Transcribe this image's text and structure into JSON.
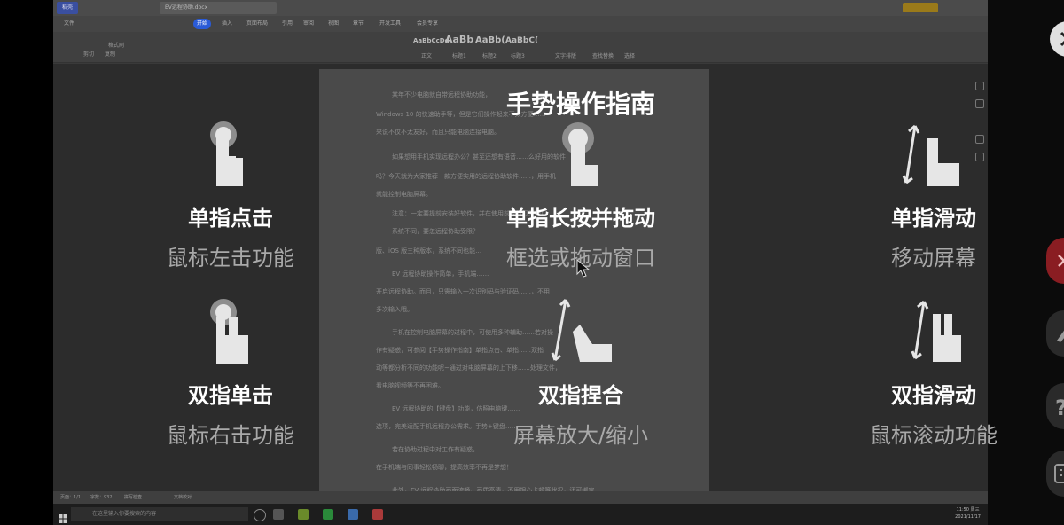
{
  "desktop": {
    "tabs": [
      "稻壳",
      "EV远程协助.docx"
    ],
    "menu": [
      "文件",
      "开始",
      "插入",
      "页面布局",
      "引用",
      "审阅",
      "视图",
      "章节",
      "开发工具",
      "会员专享"
    ],
    "ribbon_labels": [
      "剪切",
      "复制",
      "格式刷",
      "正文",
      "标题1",
      "标题2",
      "标题3",
      "文字排版",
      "查找替换",
      "选择"
    ],
    "style_previews": [
      "AaBbCcDd",
      "AaBb",
      "AaBb(",
      "AaBbC("
    ],
    "doc_lines": [
      "某年不少电脑就自带远程协助功能，",
      "Windows 10 的快速助手等，但是它们操作起来不太方便……",
      "来说不仅不太友好，而且只能电脑连接电脑。",
      "如果想用手机实现远程办公？甚至还想有语音……么好用的软件",
      "吗？今天就为大家推荐一款方便实用的远程协助软件……，用手机",
      "就能控制电脑屏幕。",
      "注意：一定要提前安装好软件，并在使用前先行打开哦！",
      "系统不同，要怎远程协助受限？",
      "版、iOS 版三种版本，系统不同也能…",
      "EV 远程协助操作简单，手机端……",
      "开启远程协助。而且，只需输入一次识别码与验证码……，不用",
      "多次输入哦。",
      "手机在控制电脑屏幕的过程中，可使用多种辅助……若对操",
      "作有疑惑，可参阅【手势操作指南】单指点击、单指……双指",
      "动等都分析不同的功能呢~通过对电脑屏幕的上下移……处理文件，",
      "看电脑视频等不再困难。",
      "EV 远程协助的【键盘】功能，仿照电脑键……",
      "选项，完美适配手机远程办公需求。手势+键盘……",
      "若在协助过程中对工作有疑惑，……",
      "在手机端与同事轻松畅聊，提高效率不再是梦想！",
      "此外，EV 远程协助画面流畅、画质高清，不用担心卡顿等状况，还可绑定"
    ],
    "status_items": [
      "页面：1/1",
      "字数：932",
      "拼写检查",
      "文档校对"
    ],
    "taskbar_search": "在这里输入你要搜索的内容",
    "clock_time": "11:50 周三",
    "clock_date": "2021/11/17"
  },
  "overlay": {
    "title": "手势操作指南",
    "gestures": [
      {
        "title": "单指点击",
        "subtitle": "鼠标左击功能",
        "icon": "single-finger-tap-icon"
      },
      {
        "title": "单指长按并拖动",
        "subtitle": "框选或拖动窗口",
        "icon": "single-finger-long-press-icon"
      },
      {
        "title": "单指滑动",
        "subtitle": "移动屏幕",
        "icon": "single-finger-swipe-icon"
      },
      {
        "title": "双指单击",
        "subtitle": "鼠标右击功能",
        "icon": "two-finger-tap-icon"
      },
      {
        "title": "双指捏合",
        "subtitle": "屏幕放大/缩小",
        "icon": "pinch-icon"
      },
      {
        "title": "双指滑动",
        "subtitle": "鼠标滚动功能",
        "icon": "two-finger-swipe-icon"
      }
    ]
  },
  "right_toolbar": {
    "buttons": [
      "close-icon",
      "close-icon",
      "pen-icon",
      "help-icon",
      "keyboard-icon"
    ]
  },
  "colors": {
    "overlay_text": "#ffffff",
    "overlay_subtext": "#a9a9a9",
    "icon_fill": "#e6e6e6",
    "accent_red": "#c4262b"
  }
}
